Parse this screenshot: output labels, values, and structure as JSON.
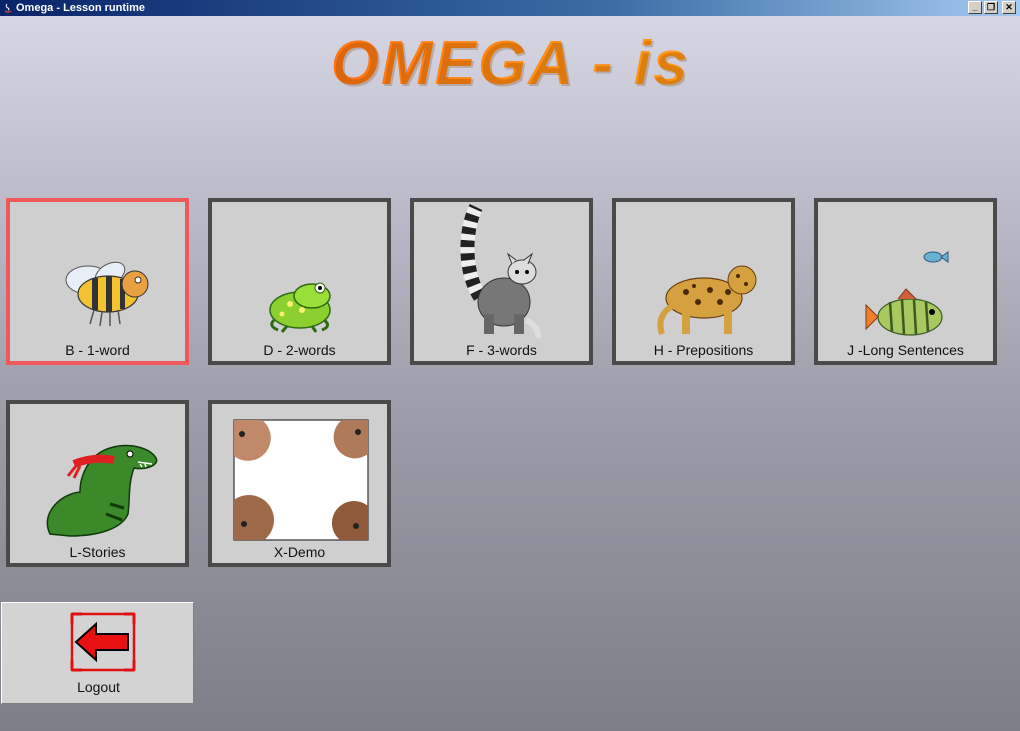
{
  "window": {
    "title": "Omega - Lesson runtime",
    "minimize_glyph": "_",
    "restore_glyph": "❐",
    "close_glyph": "✕"
  },
  "header": {
    "title": "OMEGA - is"
  },
  "lessons": [
    {
      "label": "B - 1-word",
      "icon": "bee-icon",
      "selected": true
    },
    {
      "label": "D - 2-words",
      "icon": "frog-icon"
    },
    {
      "label": "F - 3-words",
      "icon": "lemur-icon"
    },
    {
      "label": "H - Prepositions",
      "icon": "leopard-icon"
    },
    {
      "label": "J -Long Sentences",
      "icon": "fish-icon"
    },
    {
      "label": "L-Stories",
      "icon": "dinosaur-icon"
    },
    {
      "label": "X-Demo",
      "icon": "faces-photo-icon"
    }
  ],
  "logout": {
    "label": "Logout",
    "icon": "back-arrow-icon"
  },
  "colors": {
    "selected_border": "#ee5a5a",
    "tile_border": "#4a4a4a",
    "title_orange": "#ff7a10"
  }
}
